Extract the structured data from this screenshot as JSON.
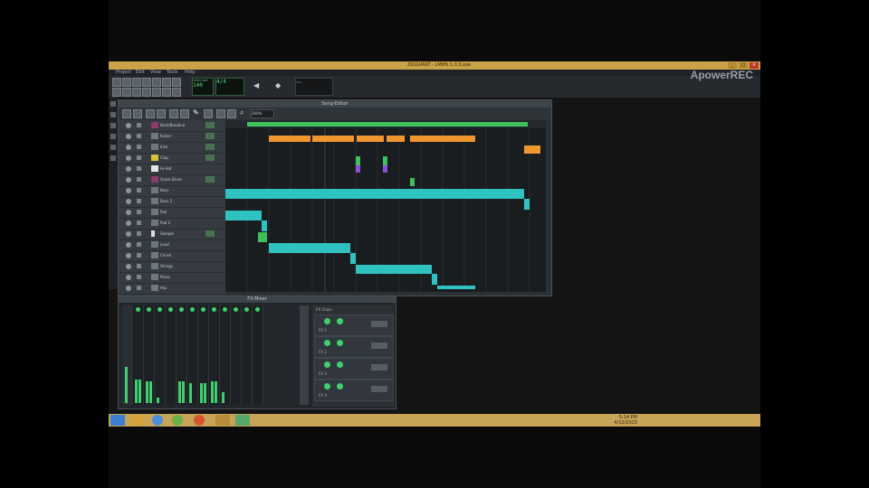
{
  "window": {
    "title": "ZIGGURAT - LMMS 1.0.3.exe",
    "controls": [
      "_",
      "□",
      "×"
    ]
  },
  "menubar": [
    "Project",
    "Edit",
    "View",
    "Tools",
    "Help"
  ],
  "toolbar": {
    "tempo_label": "TEMPO/BPM",
    "tempo_value": "140",
    "time_sig": "4/4",
    "cpu_label": "CPU"
  },
  "watermark": "ApowerREC",
  "song_editor": {
    "title": "Song-Editor",
    "zoom": "100%",
    "tracks": [
      {
        "name": "Beat/Bassline"
      },
      {
        "name": "Kicker"
      },
      {
        "name": "Kick"
      },
      {
        "name": "Clap"
      },
      {
        "name": "Hi-Hat"
      },
      {
        "name": "Snare Drum"
      },
      {
        "name": "Bass"
      },
      {
        "name": "Bass 2"
      },
      {
        "name": "Pad"
      },
      {
        "name": "Pad 2"
      },
      {
        "name": "Sample"
      },
      {
        "name": "Lead"
      },
      {
        "name": "Chord"
      },
      {
        "name": "Strings"
      },
      {
        "name": "Piano"
      },
      {
        "name": "Arp"
      }
    ]
  },
  "mixer": {
    "title": "FX-Mixer",
    "fx_label": "FX Chain",
    "fx_items": [
      "FX 1",
      "FX 2",
      "FX 3",
      "FX 4"
    ]
  },
  "taskbar": {
    "time": "5:14 PM",
    "date": "4/12/2015"
  }
}
